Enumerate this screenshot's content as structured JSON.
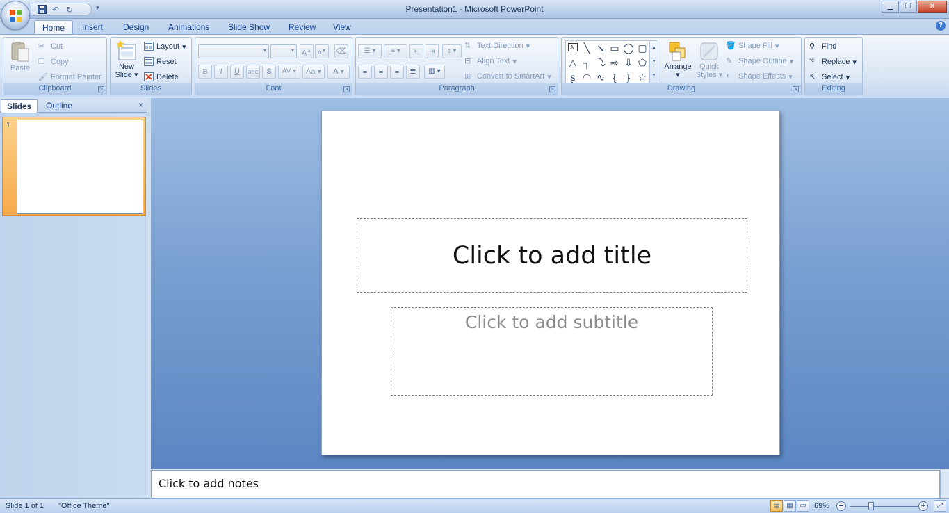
{
  "window": {
    "title": "Presentation1 - Microsoft PowerPoint"
  },
  "tabs": [
    {
      "label": "Home"
    },
    {
      "label": "Insert"
    },
    {
      "label": "Design"
    },
    {
      "label": "Animations"
    },
    {
      "label": "Slide Show"
    },
    {
      "label": "Review"
    },
    {
      "label": "View"
    }
  ],
  "ribbon": {
    "clipboard": {
      "label": "Clipboard",
      "paste": "Paste",
      "cut": "Cut",
      "copy": "Copy",
      "format_painter": "Format Painter"
    },
    "slides": {
      "label": "Slides",
      "new_slide_line1": "New",
      "new_slide_line2": "Slide",
      "layout": "Layout",
      "reset": "Reset",
      "delete": "Delete"
    },
    "font": {
      "label": "Font",
      "bold": "B",
      "italic": "I",
      "underline": "U",
      "strike": "abc",
      "shadow": "S",
      "spacing": "AV",
      "case": "Aa",
      "color": "A",
      "grow": "A",
      "shrink": "A"
    },
    "paragraph": {
      "label": "Paragraph",
      "text_direction": "Text Direction",
      "align_text": "Align Text",
      "convert_smartart": "Convert to SmartArt"
    },
    "drawing": {
      "label": "Drawing",
      "arrange": "Arrange",
      "quick_styles_line1": "Quick",
      "quick_styles_line2": "Styles",
      "shape_fill": "Shape Fill",
      "shape_outline": "Shape Outline",
      "shape_effects": "Shape Effects"
    },
    "editing": {
      "label": "Editing",
      "find": "Find",
      "replace": "Replace",
      "select": "Select"
    }
  },
  "left_panel": {
    "tab_slides": "Slides",
    "tab_outline": "Outline",
    "close": "×",
    "thumb_number": "1"
  },
  "slide": {
    "title_placeholder": "Click to add title",
    "subtitle_placeholder": "Click to add subtitle"
  },
  "notes": {
    "placeholder": "Click to add notes"
  },
  "status": {
    "slide_info": "Slide 1 of 1",
    "theme": "\"Office Theme\"",
    "zoom": "69%"
  },
  "colors": {
    "accent": "#15428b",
    "ribbon": "#dbe6f4",
    "workspace": "#7aa0d2",
    "thumb_selected": "#f7a94a"
  }
}
